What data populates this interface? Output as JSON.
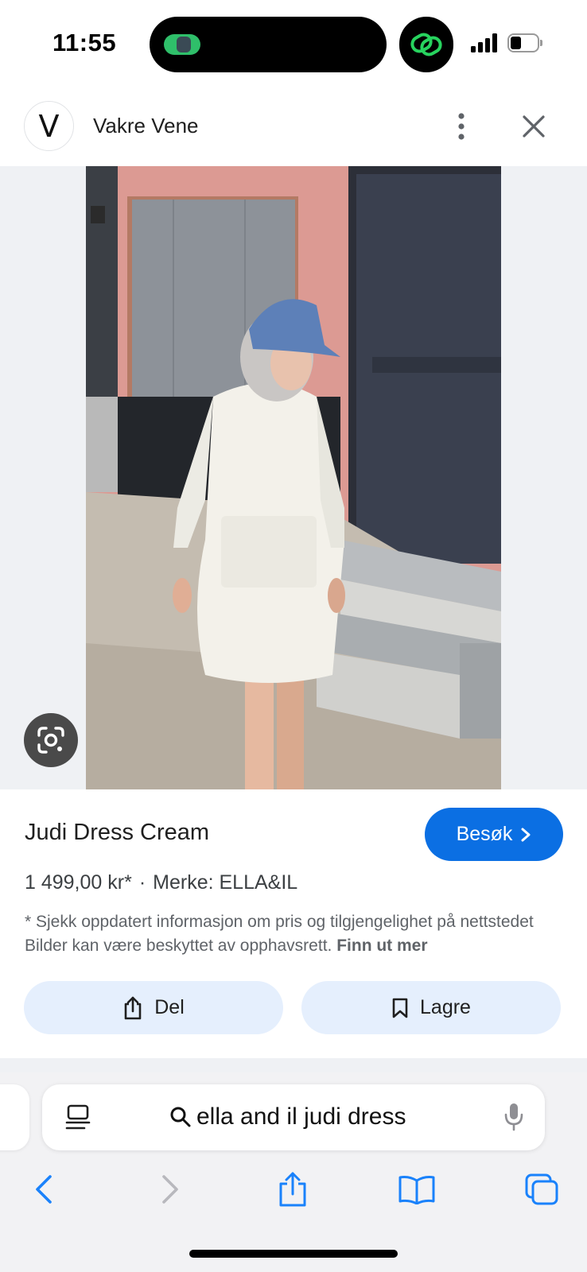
{
  "status_bar": {
    "time": "11:55"
  },
  "header": {
    "logo_letter": "V",
    "site_name": "Vakre Vene"
  },
  "product": {
    "title": "Judi Dress Cream",
    "visit_label": "Besøk",
    "price": "1 499,00 kr*",
    "separator": "·",
    "brand": "Merke: ELLA&IL",
    "disclaimer": "* Sjekk oppdatert informasjon om pris og tilgjengelighet på nettstedet Bilder kan være beskyttet av opphavsrett.",
    "learn_more": "Finn ut mer",
    "share_label": "Del",
    "save_label": "Lagre"
  },
  "safari": {
    "address_text": "ella and il judi dress"
  },
  "colors": {
    "accent": "#0b6fe3",
    "action_bg": "#e5effd",
    "safari_blue": "#1a82fb",
    "link_green": "#27d35e"
  }
}
